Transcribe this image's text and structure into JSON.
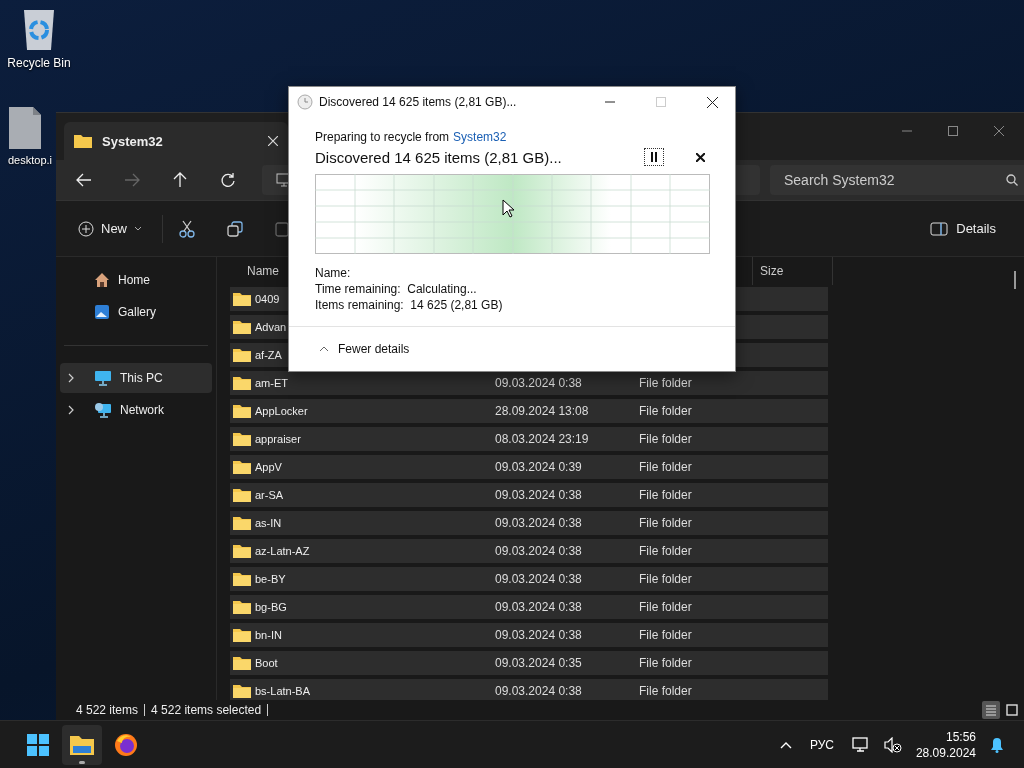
{
  "desktop": {
    "icons": [
      {
        "label": "Recycle Bin",
        "kind": "recycle-bin"
      },
      {
        "label": "desktop.i",
        "kind": "file"
      }
    ]
  },
  "explorer": {
    "tab_title": "System32",
    "nav": [
      {
        "kind": "back",
        "disabled": false
      },
      {
        "kind": "forward",
        "disabled": true
      },
      {
        "kind": "up",
        "disabled": false
      },
      {
        "kind": "refresh",
        "disabled": false
      }
    ],
    "search": {
      "placeholder": "Search System32"
    },
    "commands": {
      "new": "New",
      "details": "Details"
    },
    "sidebar": [
      {
        "label": "Home",
        "kind": "home",
        "expandable": false,
        "selected": false
      },
      {
        "label": "Gallery",
        "kind": "gallery",
        "expandable": false,
        "selected": false
      },
      {
        "label": "This PC",
        "kind": "pc",
        "expandable": true,
        "selected": true
      },
      {
        "label": "Network",
        "kind": "network",
        "expandable": true,
        "selected": false
      }
    ],
    "columns": [
      {
        "label": "Name"
      },
      {
        "label": "Size"
      }
    ],
    "rows": [
      {
        "name": "0409",
        "selected": true
      },
      {
        "name": "Advan",
        "selected": true
      },
      {
        "name": "af-ZA",
        "selected": true
      },
      {
        "name": "am-ET",
        "modified": "09.03.2024 0:38",
        "type": "File folder",
        "selected": true
      },
      {
        "name": "AppLocker",
        "modified": "28.09.2024 13:08",
        "type": "File folder",
        "selected": true
      },
      {
        "name": "appraiser",
        "modified": "08.03.2024 23:19",
        "type": "File folder",
        "selected": true
      },
      {
        "name": "AppV",
        "modified": "09.03.2024 0:39",
        "type": "File folder",
        "selected": true
      },
      {
        "name": "ar-SA",
        "modified": "09.03.2024 0:38",
        "type": "File folder",
        "selected": true
      },
      {
        "name": "as-IN",
        "modified": "09.03.2024 0:38",
        "type": "File folder",
        "selected": true
      },
      {
        "name": "az-Latn-AZ",
        "modified": "09.03.2024 0:38",
        "type": "File folder",
        "selected": true
      },
      {
        "name": "be-BY",
        "modified": "09.03.2024 0:38",
        "type": "File folder",
        "selected": true
      },
      {
        "name": "bg-BG",
        "modified": "09.03.2024 0:38",
        "type": "File folder",
        "selected": true
      },
      {
        "name": "bn-IN",
        "modified": "09.03.2024 0:38",
        "type": "File folder",
        "selected": true
      },
      {
        "name": "Boot",
        "modified": "09.03.2024 0:35",
        "type": "File folder",
        "selected": true
      },
      {
        "name": "bs-Latn-BA",
        "modified": "09.03.2024 0:38",
        "type": "File folder",
        "selected": true
      }
    ],
    "status": [
      "4 522 items",
      "4 522 items selected"
    ],
    "views": [
      {
        "kind": "details",
        "selected": true
      },
      {
        "kind": "tiles",
        "selected": false
      }
    ]
  },
  "dialog": {
    "title": "Discovered 14 625 items (2,81 GB)...",
    "source_prefix": "Preparing to recycle from",
    "source_link": "System32",
    "heading": "Discovered 14 625 items (2,81 GB)...",
    "details": [
      {
        "label": "Name:"
      },
      {
        "label": "Time remaining:",
        "value": "Calculating..."
      },
      {
        "label": "Items remaining:",
        "value": "14 625 (2,81 GB)"
      }
    ],
    "toggle": "Fewer details"
  },
  "taskbar": {
    "apps": [
      {
        "kind": "start",
        "active": false
      },
      {
        "kind": "explorer",
        "active": true
      },
      {
        "kind": "firefox",
        "active": false
      }
    ],
    "language": "РУС",
    "time": "15:56",
    "date": "28.09.2024"
  }
}
